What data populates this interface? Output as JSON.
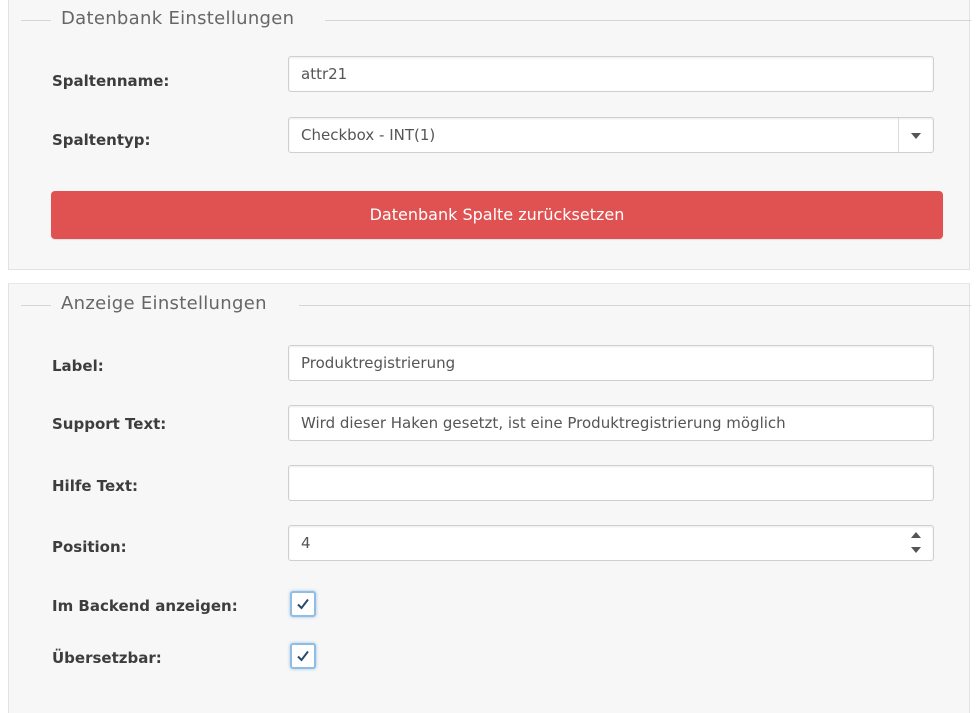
{
  "theme": {
    "accent_red": "#e05252",
    "checkbox_focus": "#8fbde3"
  },
  "db_section": {
    "legend": "Datenbank Einstellungen",
    "column_name": {
      "label": "Spaltenname:",
      "value": "attr21"
    },
    "column_type": {
      "label": "Spaltentyp:",
      "selected": "Checkbox - INT(1)",
      "icon": "chevron-down-icon"
    },
    "reset_button_label": "Datenbank Spalte zurücksetzen"
  },
  "display_section": {
    "legend": "Anzeige Einstellungen",
    "label_field": {
      "label": "Label:",
      "value": "Produktregistrierung"
    },
    "support_text": {
      "label": "Support Text:",
      "value": "Wird dieser Haken gesetzt, ist eine Produktregistrierung möglich"
    },
    "help_text": {
      "label": "Hilfe Text:",
      "value": ""
    },
    "position": {
      "label": "Position:",
      "value": "4"
    },
    "show_in_backend": {
      "label": "Im Backend anzeigen:",
      "checked": true
    },
    "translatable": {
      "label": "Übersetzbar:",
      "checked": true
    }
  }
}
